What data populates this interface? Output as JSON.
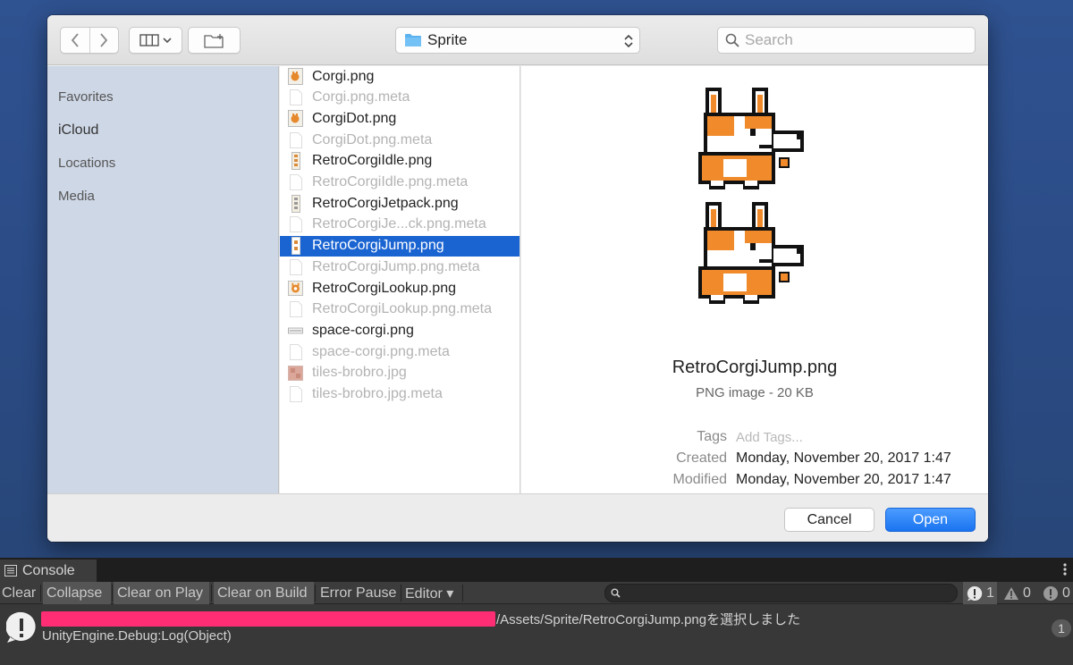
{
  "dialog": {
    "toolbar": {
      "back_icon": "chevron-left-icon",
      "forward_icon": "chevron-right-icon",
      "view_icon": "columns-view-icon",
      "new_folder_icon": "new-folder-icon",
      "path_folder": "Sprite",
      "search_placeholder": "Search"
    },
    "sidebar": {
      "items": [
        {
          "label": "Favorites",
          "strong": false
        },
        {
          "label": "iCloud",
          "strong": true
        },
        {
          "label": "Locations",
          "strong": false
        },
        {
          "label": "Media",
          "strong": false
        }
      ]
    },
    "files": [
      {
        "name": "Corgi.png",
        "enabled": true,
        "selected": false,
        "icon": "png-thumbnail-icon"
      },
      {
        "name": "Corgi.png.meta",
        "enabled": false,
        "selected": false,
        "icon": "document-icon"
      },
      {
        "name": "CorgiDot.png",
        "enabled": true,
        "selected": false,
        "icon": "png-thumbnail-icon"
      },
      {
        "name": "CorgiDot.png.meta",
        "enabled": false,
        "selected": false,
        "icon": "document-icon"
      },
      {
        "name": "RetroCorgiIdle.png",
        "enabled": true,
        "selected": false,
        "icon": "png-strip-icon"
      },
      {
        "name": "RetroCorgiIdle.png.meta",
        "enabled": false,
        "selected": false,
        "icon": "document-icon"
      },
      {
        "name": "RetroCorgiJetpack.png",
        "enabled": true,
        "selected": false,
        "icon": "png-strip-icon"
      },
      {
        "name": "RetroCorgiJe...ck.png.meta",
        "enabled": false,
        "selected": false,
        "icon": "document-icon"
      },
      {
        "name": "RetroCorgiJump.png",
        "enabled": true,
        "selected": true,
        "icon": "png-strip-icon"
      },
      {
        "name": "RetroCorgiJump.png.meta",
        "enabled": false,
        "selected": false,
        "icon": "document-icon"
      },
      {
        "name": "RetroCorgiLookup.png",
        "enabled": true,
        "selected": false,
        "icon": "png-thumbnail-icon"
      },
      {
        "name": "RetroCorgiLookup.png.meta",
        "enabled": false,
        "selected": false,
        "icon": "document-icon"
      },
      {
        "name": "space-corgi.png",
        "enabled": true,
        "selected": false,
        "icon": "png-wide-icon"
      },
      {
        "name": "space-corgi.png.meta",
        "enabled": false,
        "selected": false,
        "icon": "document-icon"
      },
      {
        "name": "tiles-brobro.jpg",
        "enabled": false,
        "selected": false,
        "icon": "jpg-thumbnail-icon"
      },
      {
        "name": "tiles-brobro.jpg.meta",
        "enabled": false,
        "selected": false,
        "icon": "document-icon"
      }
    ],
    "preview": {
      "image_icon": "corgi-sprite-preview",
      "name": "RetroCorgiJump.png",
      "kind": "PNG image - 20 KB",
      "tags_label": "Tags",
      "tags_placeholder": "Add Tags...",
      "created_label": "Created",
      "created_value": "Monday, November 20, 2017 1:47",
      "modified_label": "Modified",
      "modified_value": "Monday, November 20, 2017 1:47"
    },
    "footer": {
      "cancel_label": "Cancel",
      "open_label": "Open"
    }
  },
  "console": {
    "tab_label": "Console",
    "buttons": [
      {
        "label": "Clear",
        "on": false
      },
      {
        "label": "Collapse",
        "on": true
      },
      {
        "label": "Clear on Play",
        "on": true
      },
      {
        "label": "Clear on Build",
        "on": true
      },
      {
        "label": "Error Pause",
        "on": false
      },
      {
        "label": "Editor ▾",
        "on": false
      }
    ],
    "counts": {
      "info": "1",
      "warning": "0",
      "error": "0"
    },
    "entry": {
      "path_text": "/Assets/Sprite/RetroCorgiJump.pngを選択しました",
      "trace": "UnityEngine.Debug:Log(Object)",
      "count": "1"
    },
    "colors": {
      "redaction": "#ff2e74",
      "selection": "#1a64d2"
    }
  }
}
